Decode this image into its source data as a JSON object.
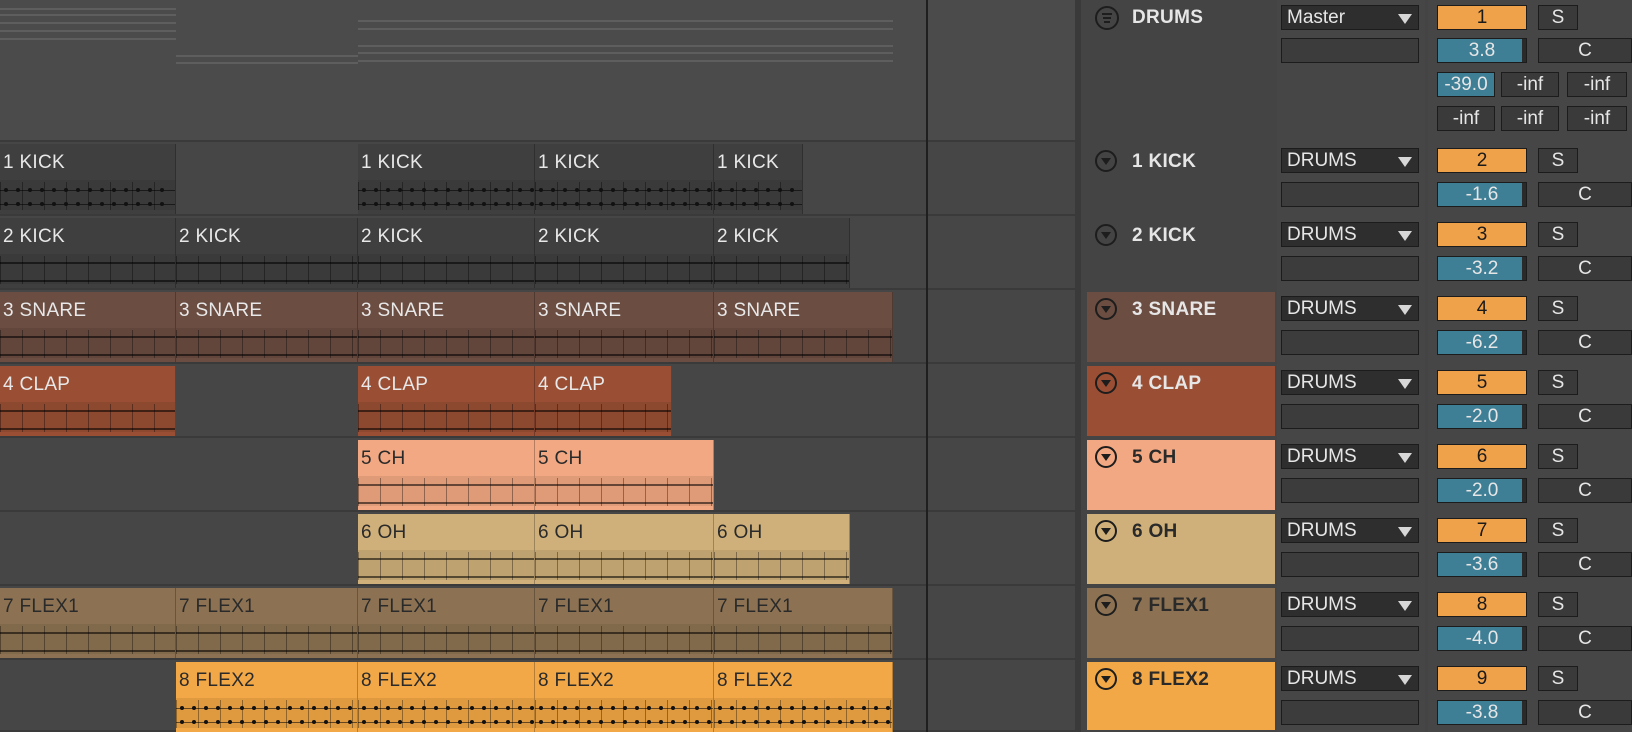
{
  "colors": {
    "kick": "#3f3f3f",
    "snare": "#6b4d42",
    "clap": "#9a4f35",
    "ch": "#f2a882",
    "oh": "#cfb07a",
    "flex1": "#8c7252",
    "flex2": "#f2a846",
    "accent": "#f0a24a",
    "volume": "#3f7f96"
  },
  "group": {
    "name": "DRUMS",
    "icon": "group-fold-icon",
    "output": "Master",
    "number": "1",
    "solo": "S",
    "volume": "3.8",
    "volume_fill": 0.95,
    "pan": "C",
    "meters": [
      "-39.0",
      "-inf",
      "-inf",
      "-inf",
      "-inf",
      "-inf"
    ]
  },
  "tracks": [
    {
      "name": "1 KICK",
      "output": "DRUMS",
      "number": "2",
      "solo": "S",
      "volume": "-1.6",
      "volume_fill": 0.95,
      "pan": "C",
      "color": "#3f3f3f"
    },
    {
      "name": "2 KICK",
      "output": "DRUMS",
      "number": "3",
      "solo": "S",
      "volume": "-3.2",
      "volume_fill": 0.95,
      "pan": "C",
      "color": "#3f3f3f"
    },
    {
      "name": "3 SNARE",
      "output": "DRUMS",
      "number": "4",
      "solo": "S",
      "volume": "-6.2",
      "volume_fill": 0.95,
      "pan": "C",
      "color": "#6b4d42"
    },
    {
      "name": "4 CLAP",
      "output": "DRUMS",
      "number": "5",
      "solo": "S",
      "volume": "-2.0",
      "volume_fill": 0.95,
      "pan": "C",
      "color": "#9a4f35"
    },
    {
      "name": "5 CH",
      "output": "DRUMS",
      "number": "6",
      "solo": "S",
      "volume": "-2.0",
      "volume_fill": 0.95,
      "pan": "C",
      "color": "#f2a882"
    },
    {
      "name": "6 OH",
      "output": "DRUMS",
      "number": "7",
      "solo": "S",
      "volume": "-3.6",
      "volume_fill": 0.95,
      "pan": "C",
      "color": "#cfb07a"
    },
    {
      "name": "7 FLEX1",
      "output": "DRUMS",
      "number": "8",
      "solo": "S",
      "volume": "-4.0",
      "volume_fill": 0.95,
      "pan": "C",
      "color": "#8c7252"
    },
    {
      "name": "8 FLEX2",
      "output": "DRUMS",
      "number": "9",
      "solo": "S",
      "volume": "-3.8",
      "volume_fill": 0.95,
      "pan": "C",
      "color": "#f2a846"
    }
  ],
  "clips": {
    "kick1": [
      "1 KICK",
      "1 KICK",
      "1 KICK",
      "1 KICK"
    ],
    "kick2": [
      "2 KICK",
      "2 KICK",
      "2 KICK",
      "2 KICK",
      "2 KICK"
    ],
    "snare": [
      "3 SNARE",
      "3 SNARE",
      "3 SNARE",
      "3 SNARE",
      "3 SNARE"
    ],
    "clap": [
      "4 CLAP",
      "4 CLAP",
      "4 CLAP"
    ],
    "ch": [
      "5 CH",
      "5 CH"
    ],
    "oh": [
      "6 OH",
      "6 OH",
      "6 OH"
    ],
    "flex1": [
      "7 FLEX1",
      "7 FLEX1",
      "7 FLEX1",
      "7 FLEX1",
      "7 FLEX1"
    ],
    "flex2": [
      "8 FLEX2",
      "8 FLEX2",
      "8 FLEX2",
      "8 FLEX2"
    ]
  }
}
